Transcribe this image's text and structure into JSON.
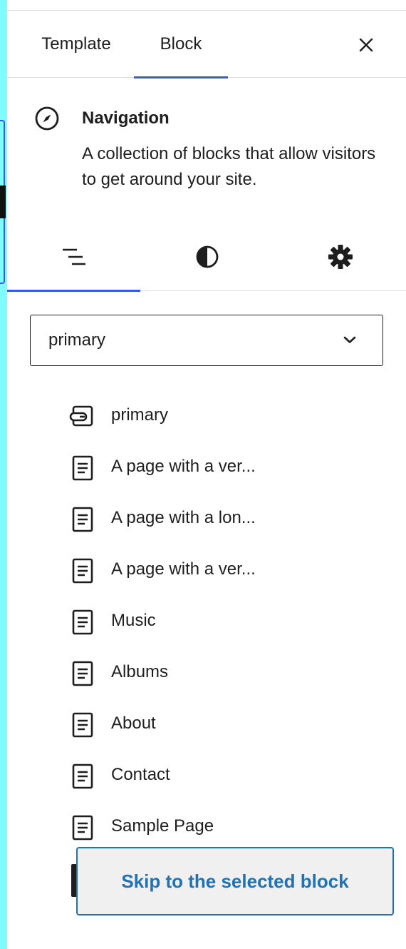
{
  "tabs": {
    "template_label": "Template",
    "block_label": "Block",
    "close_icon": "close-icon"
  },
  "block_card": {
    "icon": "compass-icon",
    "title": "Navigation",
    "description": "A collection of blocks that allow visitors to get around your site."
  },
  "inspector_tabs": [
    {
      "icon": "list-view-icon",
      "active": true
    },
    {
      "icon": "styles-half-circle-icon",
      "active": false
    },
    {
      "icon": "gear-icon",
      "active": false
    }
  ],
  "menu_select": {
    "value": "primary",
    "icon": "chevron-down-icon"
  },
  "menu_items": [
    {
      "label": "primary",
      "icon": "link-icon"
    },
    {
      "label": "A page with a ver...",
      "icon": "page-icon"
    },
    {
      "label": "A page with a lon...",
      "icon": "page-icon"
    },
    {
      "label": "A page with a ver...",
      "icon": "page-icon"
    },
    {
      "label": "Music",
      "icon": "page-icon"
    },
    {
      "label": "Albums",
      "icon": "page-icon"
    },
    {
      "label": "About",
      "icon": "page-icon"
    },
    {
      "label": "Contact",
      "icon": "page-icon"
    },
    {
      "label": "Sample Page",
      "icon": "page-icon"
    }
  ],
  "skip_button": {
    "label": "Skip to the selected block"
  },
  "colors": {
    "accent": "#3858e9",
    "link": "#2271b1",
    "canvas_edge": "#7ffcff",
    "text": "#1e1e1e"
  }
}
